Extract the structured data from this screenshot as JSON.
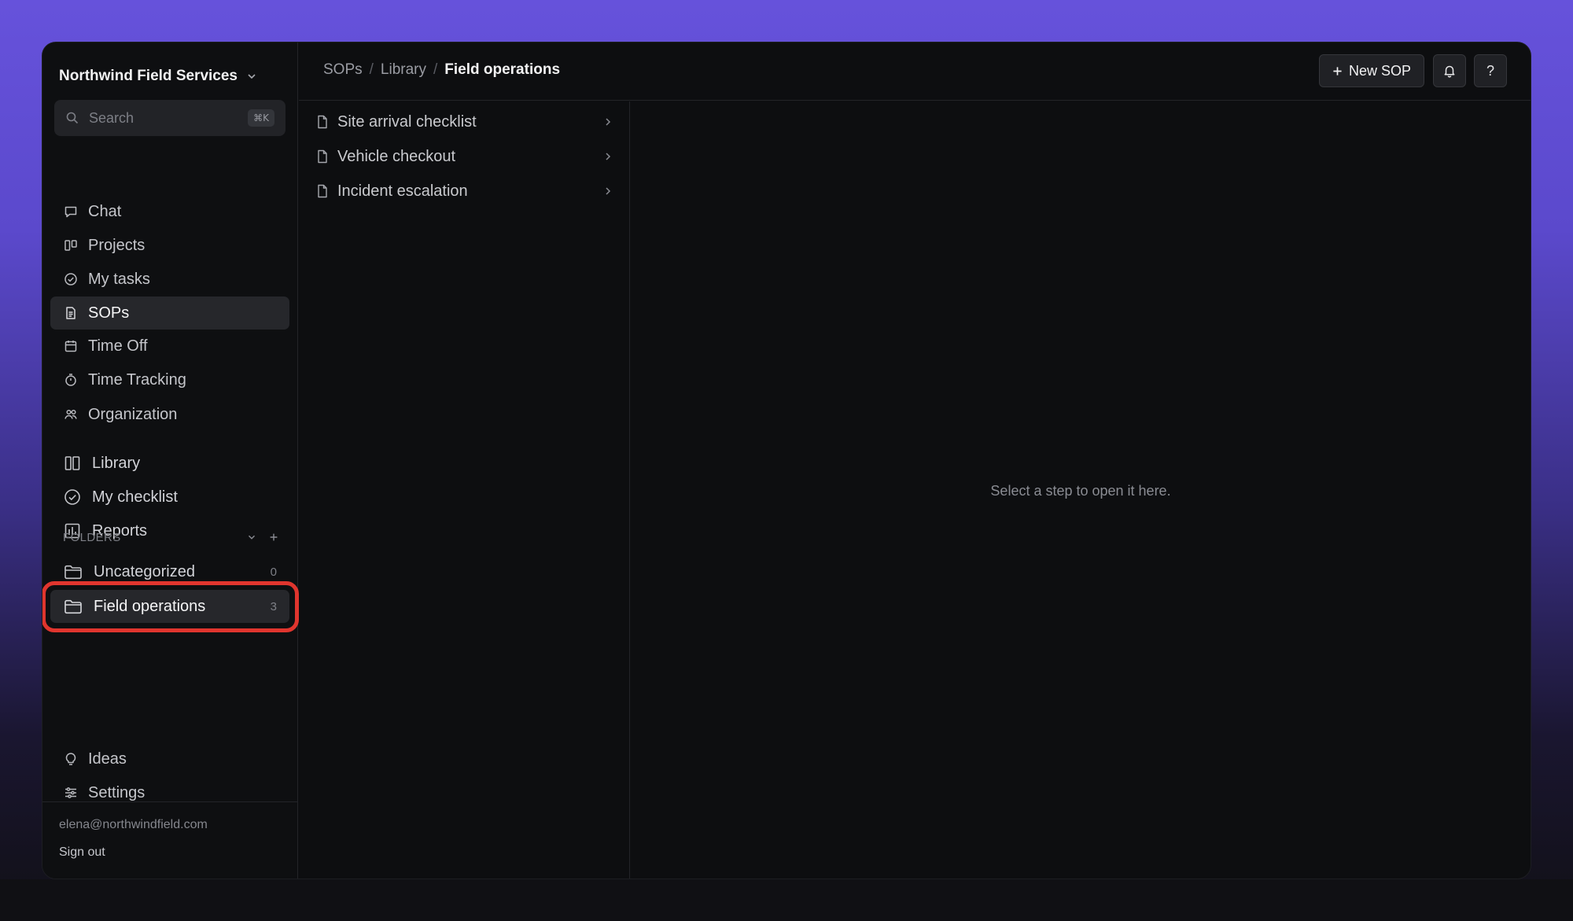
{
  "workspace": {
    "name": "Northwind Field Services"
  },
  "search": {
    "placeholder": "Search",
    "shortcut": "⌘K"
  },
  "nav": {
    "primary": [
      {
        "label": "Chat",
        "icon": "chat-icon"
      },
      {
        "label": "Projects",
        "icon": "projects-icon"
      },
      {
        "label": "My tasks",
        "icon": "check-circle-icon"
      },
      {
        "label": "SOPs",
        "icon": "document-icon",
        "active": true
      },
      {
        "label": "Time Off",
        "icon": "calendar-icon"
      },
      {
        "label": "Time Tracking",
        "icon": "stopwatch-icon"
      },
      {
        "label": "Organization",
        "icon": "people-icon"
      }
    ],
    "secondary": [
      {
        "label": "Library",
        "icon": "library-icon"
      },
      {
        "label": "My checklist",
        "icon": "check-circle-icon"
      },
      {
        "label": "Reports",
        "icon": "reports-icon"
      }
    ],
    "bottom": [
      {
        "label": "Ideas",
        "icon": "lightbulb-icon"
      },
      {
        "label": "Settings",
        "icon": "sliders-icon"
      }
    ]
  },
  "folders": {
    "header": "FOLDERS",
    "items": [
      {
        "label": "Uncategorized",
        "count": "0"
      },
      {
        "label": "Field operations",
        "count": "3",
        "active": true
      }
    ]
  },
  "user": {
    "email": "elena@northwindfield.com",
    "signout": "Sign out"
  },
  "breadcrumb": {
    "root": "SOPs",
    "middle": "Library",
    "current": "Field operations",
    "separator": "/"
  },
  "toolbar": {
    "new_sop": "New SOP",
    "help": "?"
  },
  "sop_list": [
    {
      "title": "Site arrival checklist"
    },
    {
      "title": "Vehicle checkout"
    },
    {
      "title": "Incident escalation"
    }
  ],
  "detail": {
    "empty_message": "Select a step to open it here."
  },
  "colors": {
    "highlight": "#e0352e",
    "accent_bg": "#6652db"
  }
}
